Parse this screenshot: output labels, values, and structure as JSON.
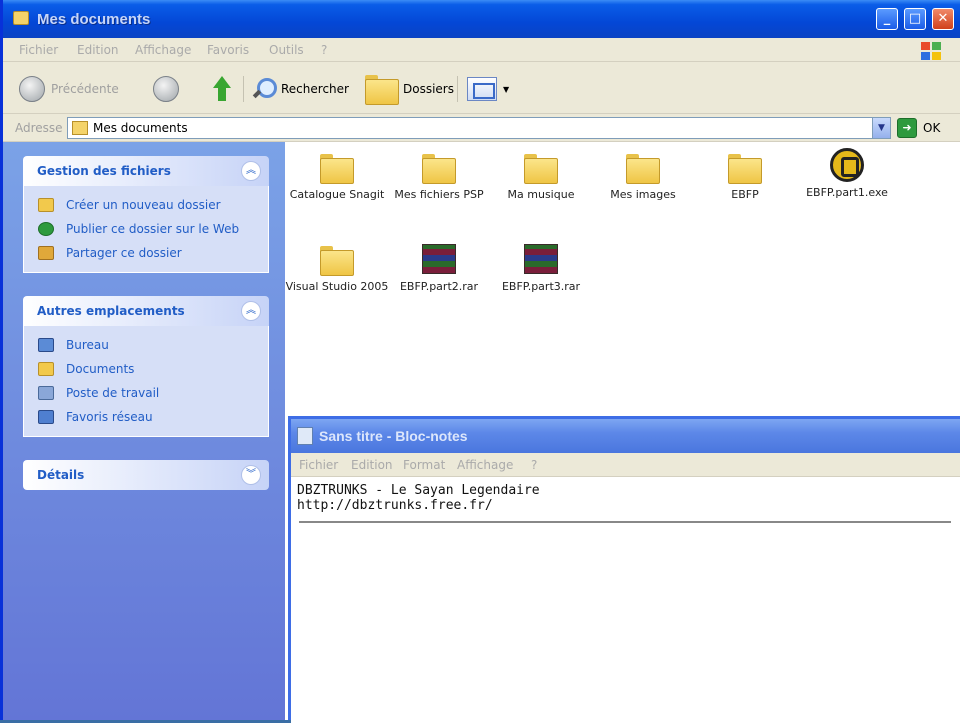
{
  "explorer": {
    "title": "Mes documents",
    "window_controls": {
      "minimize": "_",
      "maximize": "□",
      "close": "✕"
    },
    "menu": [
      "Fichier",
      "Edition",
      "Affichage",
      "Favoris",
      "Outils",
      "?"
    ],
    "toolbar": {
      "back_label": "Précédente",
      "search_label": "Rechercher",
      "folders_label": "Dossiers"
    },
    "address": {
      "label": "Adresse",
      "value": "Mes documents",
      "go_label": "OK"
    },
    "task_pane": {
      "file_tasks": {
        "title": "Gestion des fichiers",
        "items": [
          {
            "label": "Créer un nouveau dossier",
            "icon": "new-folder-icon",
            "color": "#f2c94c"
          },
          {
            "label": "Publier ce dossier sur le Web",
            "icon": "globe-icon",
            "color": "#2e9a3e"
          },
          {
            "label": "Partager ce dossier",
            "icon": "share-folder-icon",
            "color": "#e0a83a"
          }
        ]
      },
      "other_places": {
        "title": "Autres emplacements",
        "items": [
          {
            "label": "Bureau",
            "icon": "desktop-icon",
            "color": "#5b8bd6"
          },
          {
            "label": "Documents",
            "icon": "documents-folder-icon",
            "color": "#f2c94c"
          },
          {
            "label": "Poste de travail",
            "icon": "my-computer-icon",
            "color": "#8aa7d8"
          },
          {
            "label": "Favoris réseau",
            "icon": "network-icon",
            "color": "#4f7fd0"
          }
        ]
      },
      "details": {
        "title": "Détails"
      }
    },
    "files": [
      {
        "name": "Catalogue Snagit",
        "type": "folder"
      },
      {
        "name": "Mes fichiers PSP",
        "type": "folder"
      },
      {
        "name": "Ma musique",
        "type": "folder"
      },
      {
        "name": "Mes images",
        "type": "folder"
      },
      {
        "name": "EBFP",
        "type": "folder"
      },
      {
        "name": "EBFP.part1.exe",
        "type": "exe"
      },
      {
        "name": "Visual Studio 2005",
        "type": "folder"
      },
      {
        "name": "EBFP.part2.rar",
        "type": "rar"
      },
      {
        "name": "EBFP.part3.rar",
        "type": "rar"
      }
    ]
  },
  "notepad": {
    "title": "Sans titre - Bloc-notes",
    "menu": [
      "Fichier",
      "Edition",
      "Format",
      "Affichage",
      "?"
    ],
    "lines": [
      "DBZTRUNKS - Le Sayan Legendaire",
      "http://dbztrunks.free.fr/"
    ]
  }
}
